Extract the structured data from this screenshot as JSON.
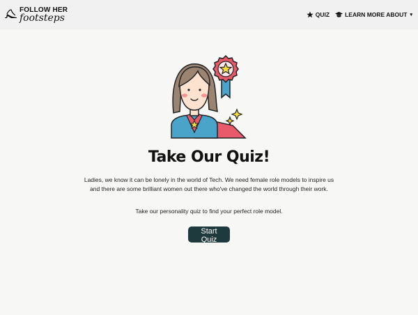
{
  "brand": {
    "line1": "FOLLOW HER",
    "line2": "footsteps"
  },
  "nav": {
    "quiz_label": "QUIZ",
    "learn_label": "LEARN MORE ABOUT",
    "icons": {
      "quiz": "star-icon",
      "learn": "graduation-cap-icon",
      "dropdown": "caret-down-icon"
    }
  },
  "main": {
    "title": "Take Our Quiz!",
    "intro": "Ladies, we know it can be lonely in the world of Tech. We need female role models to inspire us and there are some brilliant women out there who've changed the world through their work.",
    "subtext": "Take our personality quiz to find your perfect role model.",
    "start_label": "Start Quiz"
  },
  "colors": {
    "background": "#f7f7f6",
    "navbar": "#f1f1f1",
    "button": "#1f3a3d",
    "medal_ribbon": "#4aa3c9",
    "medal_badge": "#e85a6a",
    "star": "#f7df3a"
  }
}
